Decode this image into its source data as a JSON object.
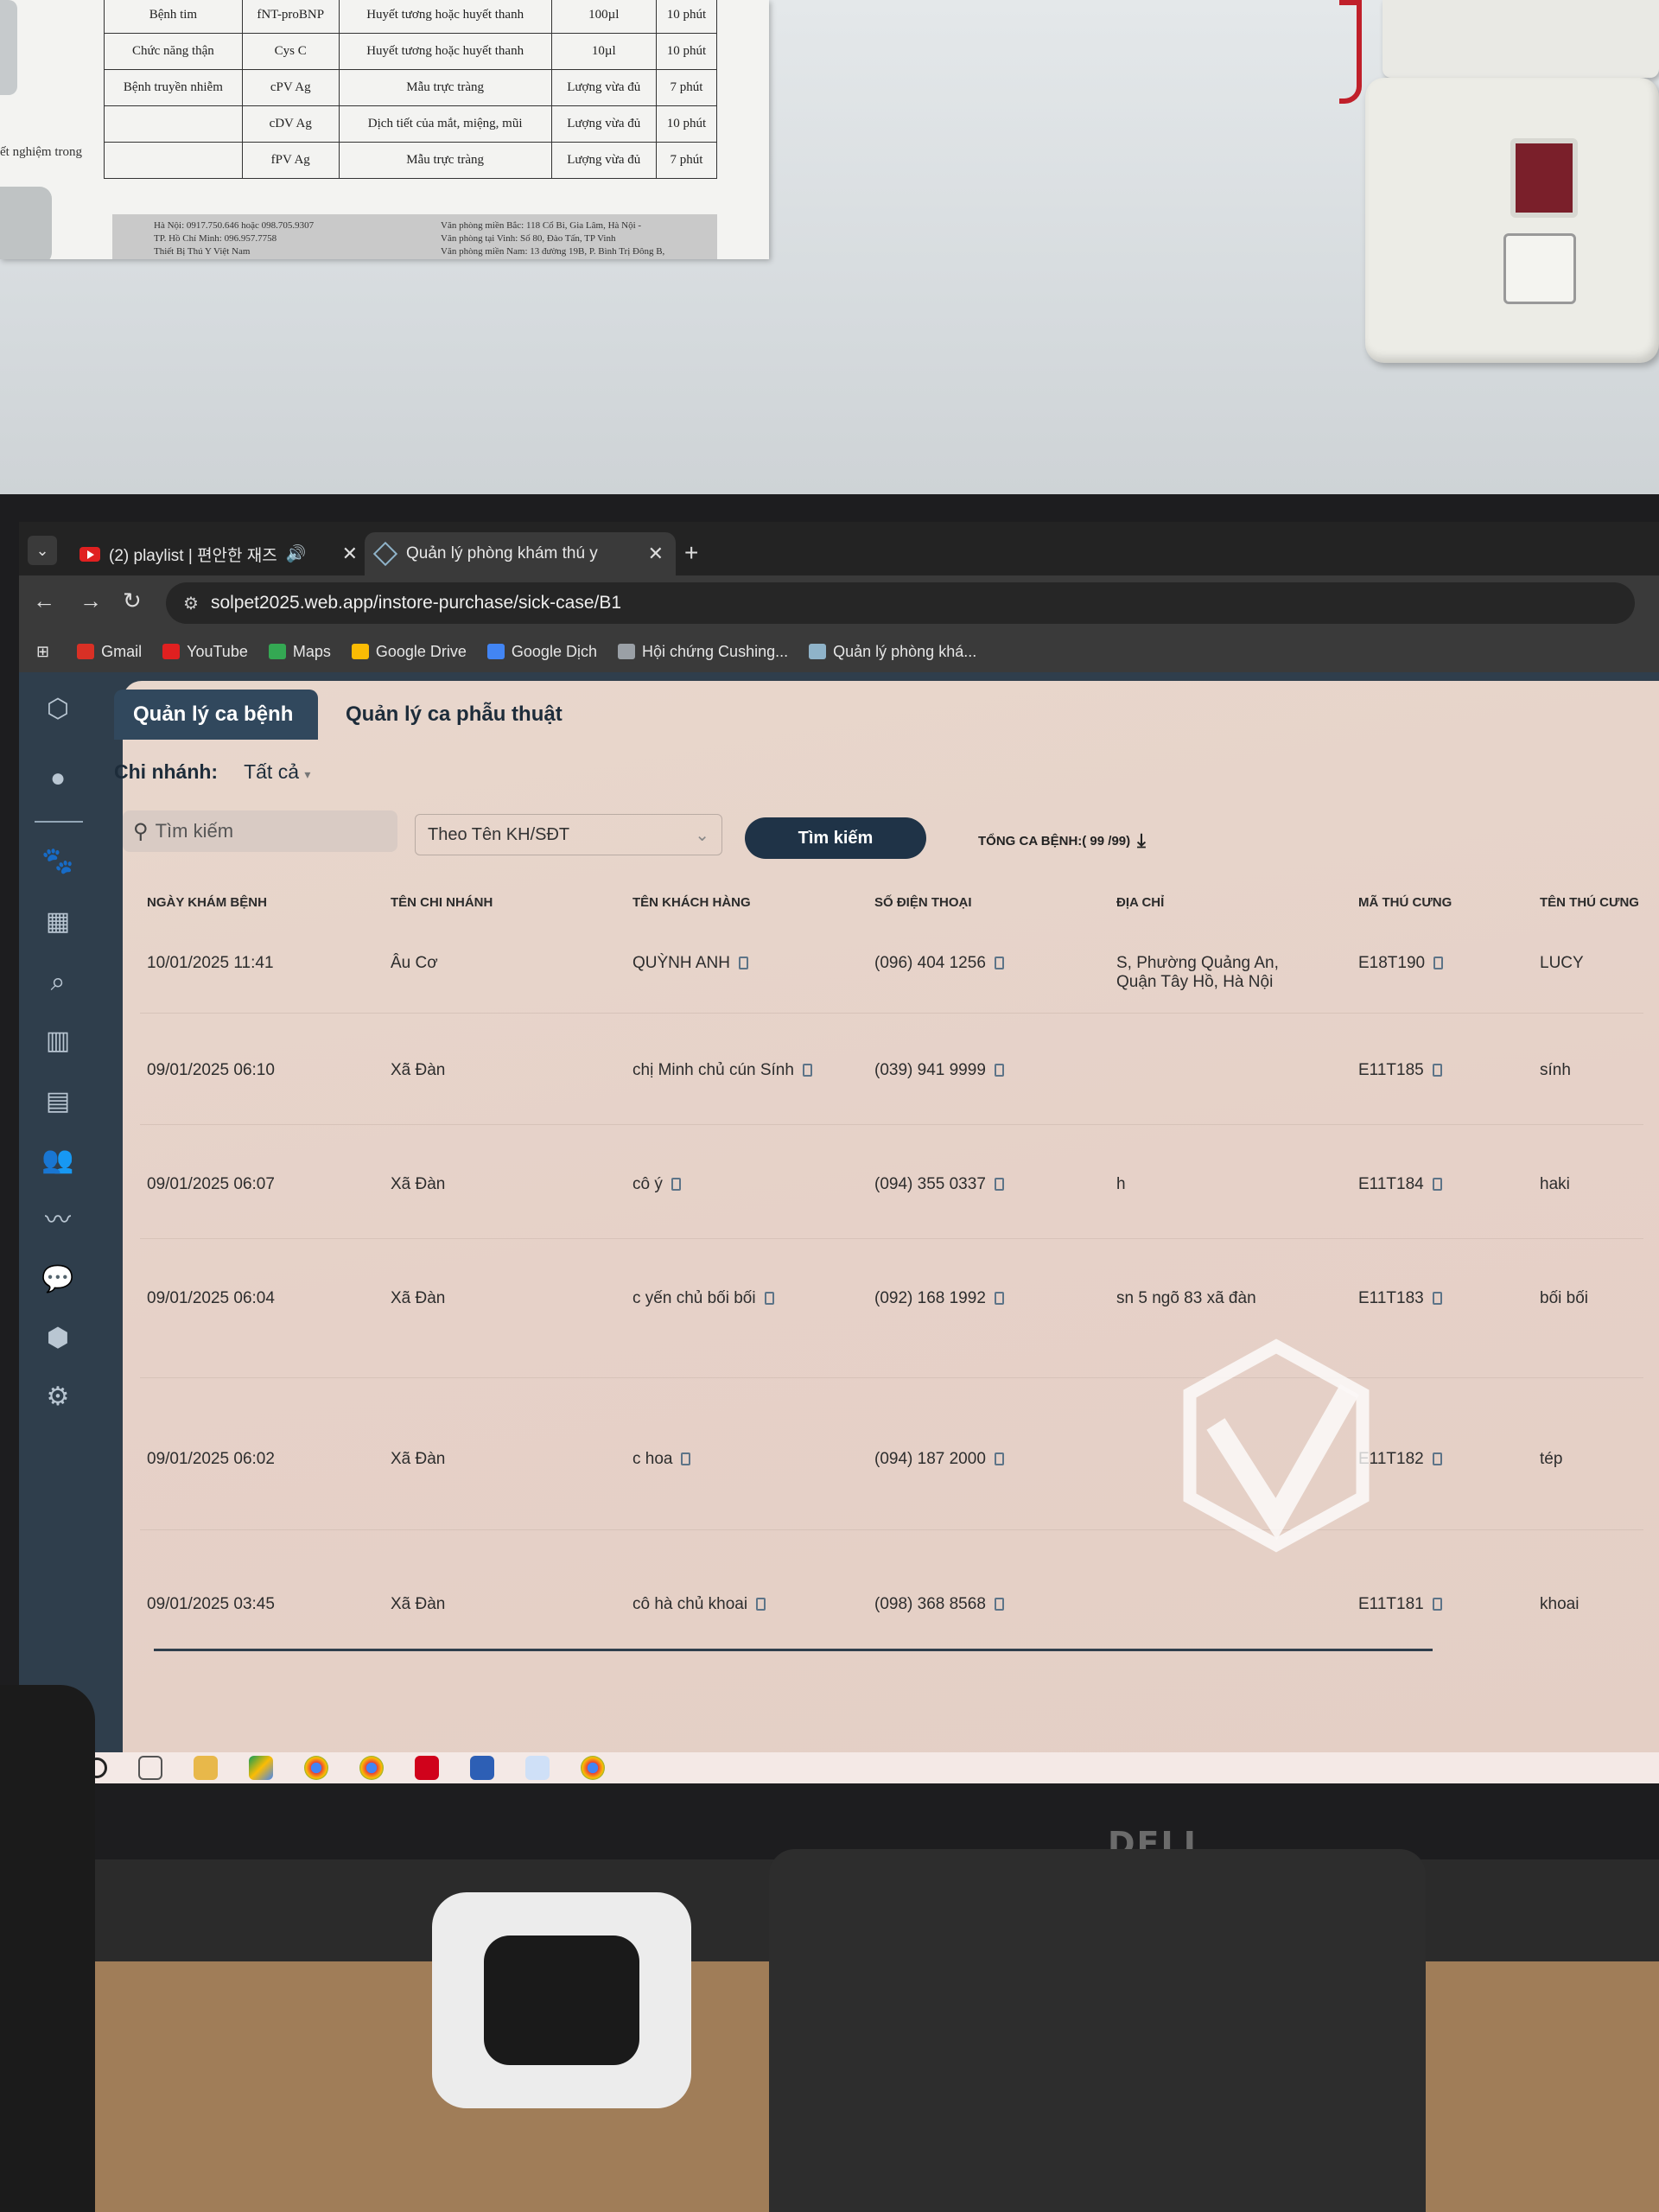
{
  "poster": {
    "rows": [
      [
        "Bệnh tim",
        "fNT-proBNP",
        "Huyết tương hoặc huyết thanh",
        "100µl",
        "10 phút"
      ],
      [
        "Chức năng thận",
        "Cys C",
        "Huyết tương hoặc huyết thanh",
        "10µl",
        "10 phút"
      ],
      [
        "Bệnh truyền nhiễm",
        "cPV Ag",
        "Mẫu trực tràng",
        "Lượng vừa đủ",
        "7 phút"
      ],
      [
        "",
        "cDV Ag",
        "Dịch tiết của mắt, miệng, mũi",
        "Lượng vừa đủ",
        "10 phút"
      ],
      [
        "",
        "fPV Ag",
        "Mẫu trực tràng",
        "Lượng vừa đủ",
        "7 phút"
      ]
    ],
    "left_text": "ết nghiệm trong",
    "footer": {
      "left": [
        "Hà Nội: 0917.750.646 hoặc 098.705.9307",
        "TP. Hồ Chí Minh: 096.957.7758",
        "Thiết Bị Thú Y Việt Nam"
      ],
      "right": [
        "Văn phòng miền Bắc: 118 Cổ Bi, Gia Lâm, Hà Nội -",
        "Văn phòng tại Vinh: Số 80, Đào Tấn, TP Vinh",
        "Văn phòng miền Nam: 13 đường 19B, P. Bình Trị Đông B,"
      ]
    }
  },
  "browser": {
    "tabs": [
      {
        "label": "(2) playlist | 편안한 재즈",
        "active": false
      },
      {
        "label": "Quản lý phòng khám thú y",
        "active": true
      }
    ],
    "new_tab": "+",
    "url": "solpet2025.web.app/instore-purchase/sick-case/B1",
    "bookmarks": [
      {
        "label": "Gmail",
        "icon": "gmail-icon",
        "color": "#d93025"
      },
      {
        "label": "YouTube",
        "icon": "youtube-icon",
        "color": "#e02020"
      },
      {
        "label": "Maps",
        "icon": "maps-icon",
        "color": "#34a853"
      },
      {
        "label": "Google Drive",
        "icon": "drive-icon",
        "color": "#fbbc04"
      },
      {
        "label": "Google Dịch",
        "icon": "translate-icon",
        "color": "#4285f4"
      },
      {
        "label": "Hội chứng Cushing...",
        "icon": "page-icon",
        "color": "#9aa0a6"
      },
      {
        "label": "Quản lý phòng khá...",
        "icon": "solpet-icon",
        "color": "#8fb3c9"
      }
    ]
  },
  "app": {
    "tabs": {
      "active": "Quản lý ca bệnh",
      "inactive": "Quản lý ca phẫu thuật"
    },
    "branch": {
      "label": "Chi nhánh:",
      "value": "Tất cả"
    },
    "search": {
      "placeholder": "Tìm kiếm",
      "filter": "Theo Tên KH/SĐT",
      "button": "Tìm kiếm"
    },
    "total": "TỔNG CA BỆNH:( 99 /99)",
    "columns": [
      "NGÀY KHÁM BỆNH",
      "TÊN CHI NHÁNH",
      "TÊN KHÁCH HÀNG",
      "SỐ ĐIỆN THOẠI",
      "ĐỊA CHỈ",
      "MÃ THÚ CƯNG",
      "TÊN THÚ CƯNG"
    ],
    "rows": [
      {
        "date": "10/01/2025 11:41",
        "branch": "Âu Cơ",
        "customer": "QUỲNH ANH",
        "phone": "(096) 404 1256",
        "address": "S, Phường Quảng An, Quận Tây Hồ, Hà Nội",
        "pet_code": "E18T190",
        "pet_name": "LUCY"
      },
      {
        "date": "09/01/2025 06:10",
        "branch": "Xã Đàn",
        "customer": "chị Minh chủ cún Sính",
        "phone": "(039) 941 9999",
        "address": "",
        "pet_code": "E11T185",
        "pet_name": "sính"
      },
      {
        "date": "09/01/2025 06:07",
        "branch": "Xã Đàn",
        "customer": "cô ý",
        "phone": "(094) 355 0337",
        "address": "h",
        "pet_code": "E11T184",
        "pet_name": "haki"
      },
      {
        "date": "09/01/2025 06:04",
        "branch": "Xã Đàn",
        "customer": "c yến chủ bối bối",
        "phone": "(092) 168 1992",
        "address": "sn 5 ngõ 83 xã đàn",
        "pet_code": "E11T183",
        "pet_name": "bối bối"
      },
      {
        "date": "09/01/2025 06:02",
        "branch": "Xã Đàn",
        "customer": "c hoa",
        "phone": "(094) 187 2000",
        "address": "",
        "pet_code": "E11T182",
        "pet_name": "tép"
      },
      {
        "date": "09/01/2025 03:45",
        "branch": "Xã Đàn",
        "customer": "cô hà chủ khoai",
        "phone": "(098) 368 8568",
        "address": "",
        "pet_code": "E11T181",
        "pet_name": "khoai"
      }
    ]
  },
  "monitor_brand": "DELL"
}
